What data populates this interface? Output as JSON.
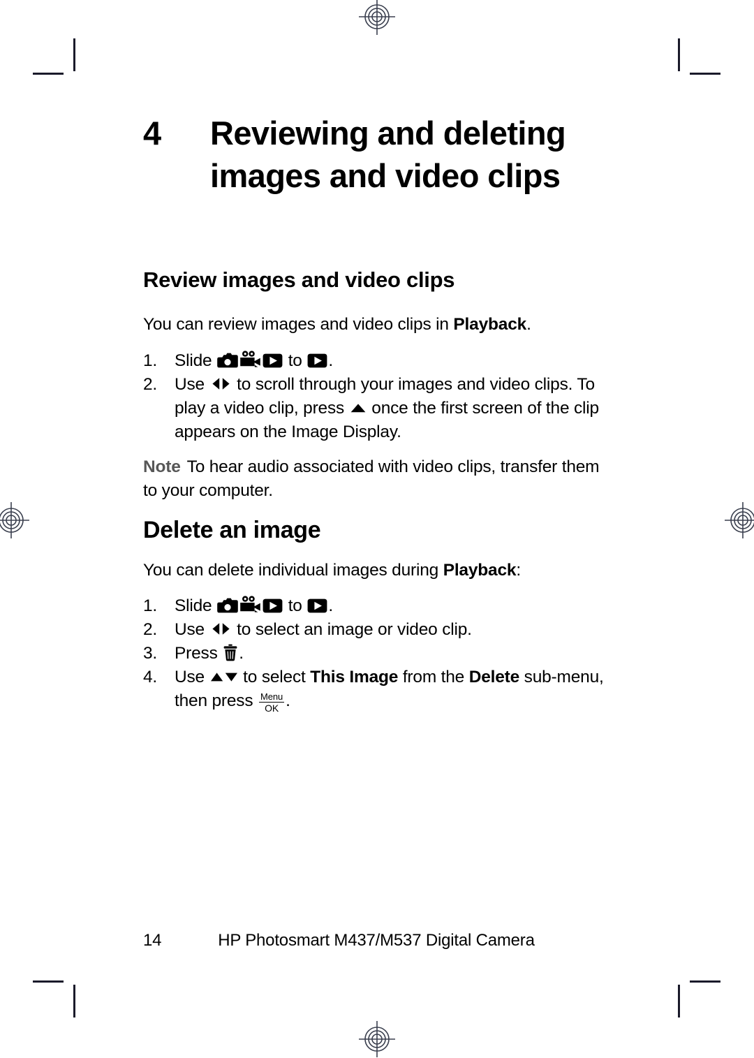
{
  "document": {
    "chapter_number": "4",
    "chapter_title": "Reviewing and deleting images and video clips"
  },
  "sections": {
    "review": {
      "heading": "Review images and video clips",
      "intro_before": "You can review images and video clips in ",
      "intro_bold": "Playback",
      "intro_after": ".",
      "step1": {
        "number": "1.",
        "text_before": "Slide ",
        "icon_camera": "camera-icon",
        "icon_video": "video-camera-icon",
        "icon_playback": "playback-icon",
        "text_middle": " to ",
        "icon_target": "playback-icon",
        "text_after": "."
      },
      "step2": {
        "number": "2.",
        "text_before": "Use ",
        "icon_leftright": "left-right-arrows-icon",
        "text_middle": " to scroll through your images and video clips. To play a video clip, press ",
        "icon_up": "up-arrow-icon",
        "text_after": " once the first screen of the clip appears on the Image Display."
      }
    },
    "note": {
      "label": "Note",
      "text": "To hear audio associated with video clips, transfer them to your computer."
    },
    "delete": {
      "heading": "Delete an image",
      "intro_before": "You can delete individual images during ",
      "intro_bold": "Playback",
      "intro_after": ":",
      "step1": {
        "number": "1.",
        "text_before": "Slide ",
        "icon_camera": "camera-icon",
        "icon_video": "video-camera-icon",
        "icon_playback": "playback-icon",
        "text_middle": " to ",
        "icon_target": "playback-icon",
        "text_after": "."
      },
      "step2": {
        "number": "2.",
        "text_before": "Use ",
        "icon_leftright": "left-right-arrows-icon",
        "text_after": " to select an image or video clip."
      },
      "step3": {
        "number": "3.",
        "text_before": "Press ",
        "icon_trash": "trash-icon",
        "text_after": "."
      },
      "step4": {
        "number": "4.",
        "text_before": "Use ",
        "icon_updown": "up-down-arrows-icon",
        "text_mid1": " to select ",
        "bold1": "This Image",
        "text_mid2": " from the ",
        "bold2": "Delete",
        "text_mid3": " sub-menu, then press ",
        "icon_menuok_top": "Menu",
        "icon_menuok_bottom": "OK",
        "text_after": "."
      }
    }
  },
  "footer": {
    "page_number": "14",
    "title": "HP Photosmart M437/M537 Digital Camera"
  },
  "print_marks": {
    "registration_icon": "registration-target-icon",
    "crop_icon": "crop-mark-icon"
  }
}
